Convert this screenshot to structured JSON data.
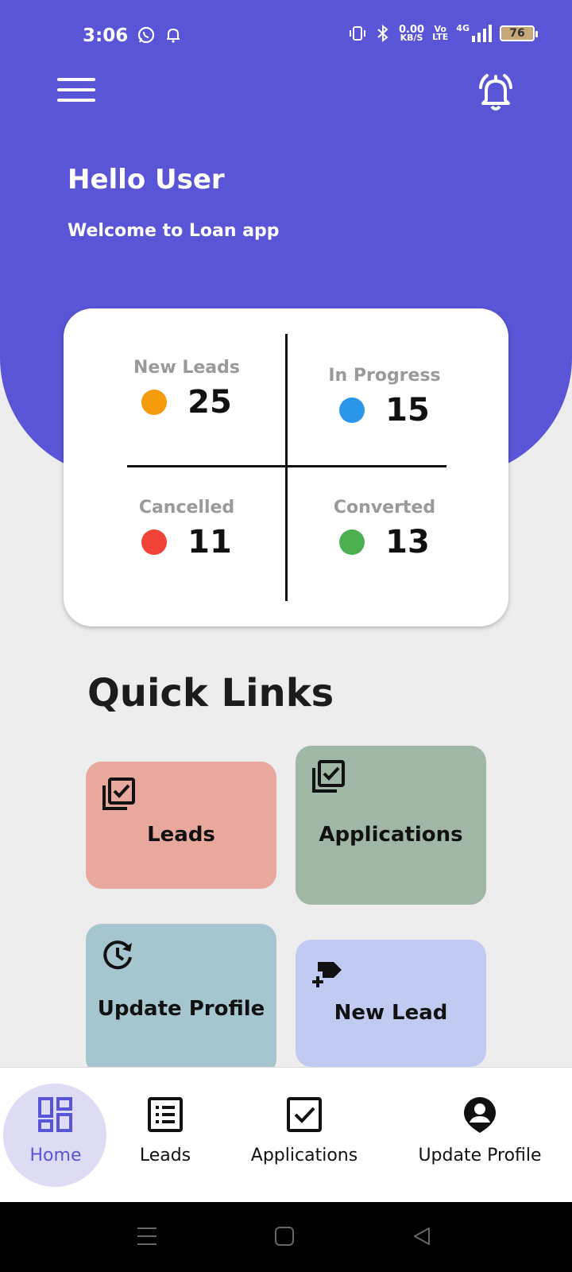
{
  "status_bar": {
    "time": "3:06",
    "net_speed_top": "0.00",
    "net_speed_bottom": "KB/S",
    "volte_top": "Vo",
    "volte_bottom": "LTE",
    "network": "4G",
    "battery": "76"
  },
  "header": {
    "greeting": "Hello User",
    "welcome": "Welcome to Loan app",
    "bg_color": "#5a55d6"
  },
  "stats": [
    {
      "label": "New Leads",
      "value": "25",
      "color": "#f59b0c"
    },
    {
      "label": "In Progress",
      "value": "15",
      "color": "#2a96ea"
    },
    {
      "label": "Cancelled",
      "value": "11",
      "color": "#f04236"
    },
    {
      "label": "Converted",
      "value": "13",
      "color": "#4caf50"
    }
  ],
  "quick_links": {
    "title": "Quick Links",
    "tiles": [
      {
        "label": "Leads",
        "icon": "checklist-icon",
        "color": "#e8a89d"
      },
      {
        "label": "Applications",
        "icon": "checklist-icon",
        "color": "#a1b7a5"
      },
      {
        "label": "Update Profile",
        "icon": "history-icon",
        "color": "#a5c6cf"
      },
      {
        "label": "New Lead",
        "icon": "add-label-icon",
        "color": "#c1caf0"
      }
    ]
  },
  "bottom_nav": [
    {
      "label": "Home",
      "icon": "dashboard-icon",
      "active": true
    },
    {
      "label": "Leads",
      "icon": "list-icon",
      "active": false
    },
    {
      "label": "Applications",
      "icon": "checkbox-icon",
      "active": false
    },
    {
      "label": "Update Profile",
      "icon": "account-pin-icon",
      "active": false
    }
  ]
}
